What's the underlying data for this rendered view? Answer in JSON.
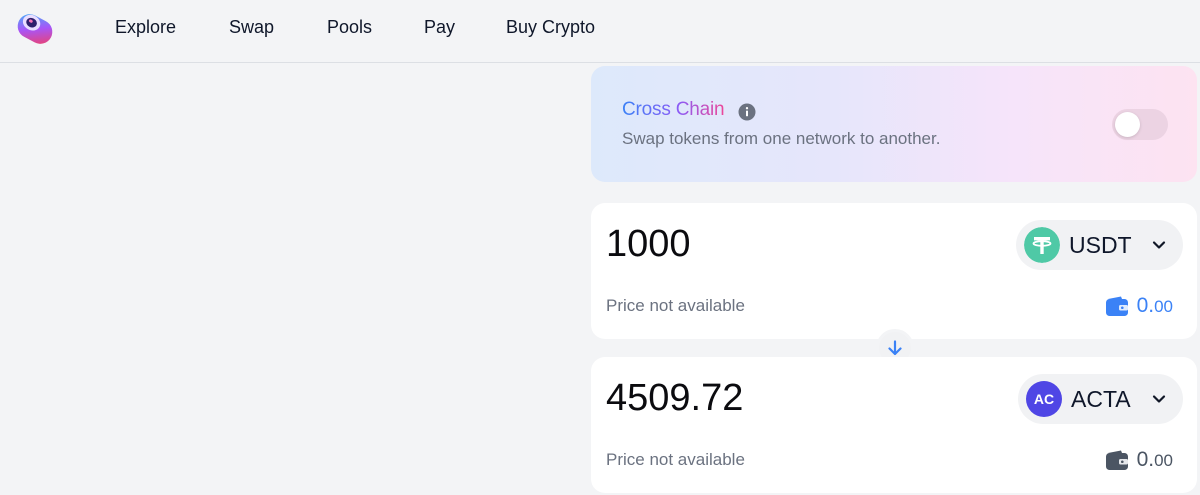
{
  "header": {
    "nav": [
      {
        "label": "Explore"
      },
      {
        "label": "Swap"
      },
      {
        "label": "Pools"
      },
      {
        "label": "Pay"
      },
      {
        "label": "Buy Crypto"
      }
    ]
  },
  "cross_chain": {
    "title": "Cross Chain",
    "subtitle": "Swap tokens from one network to another.",
    "enabled": false
  },
  "swap": {
    "from": {
      "amount": "1000",
      "token_symbol": "USDT",
      "price_note": "Price not available",
      "balance_int": "0.",
      "balance_dec": "00"
    },
    "to": {
      "amount": "4509.72",
      "token_symbol": "ACTA",
      "token_icon_text": "AC",
      "price_note": "Price not available",
      "balance_int": "0.",
      "balance_dec": "00"
    }
  },
  "colors": {
    "accent": "#3b82f6",
    "usdt": "#4fc9a6",
    "acta": "#4f46e5"
  }
}
